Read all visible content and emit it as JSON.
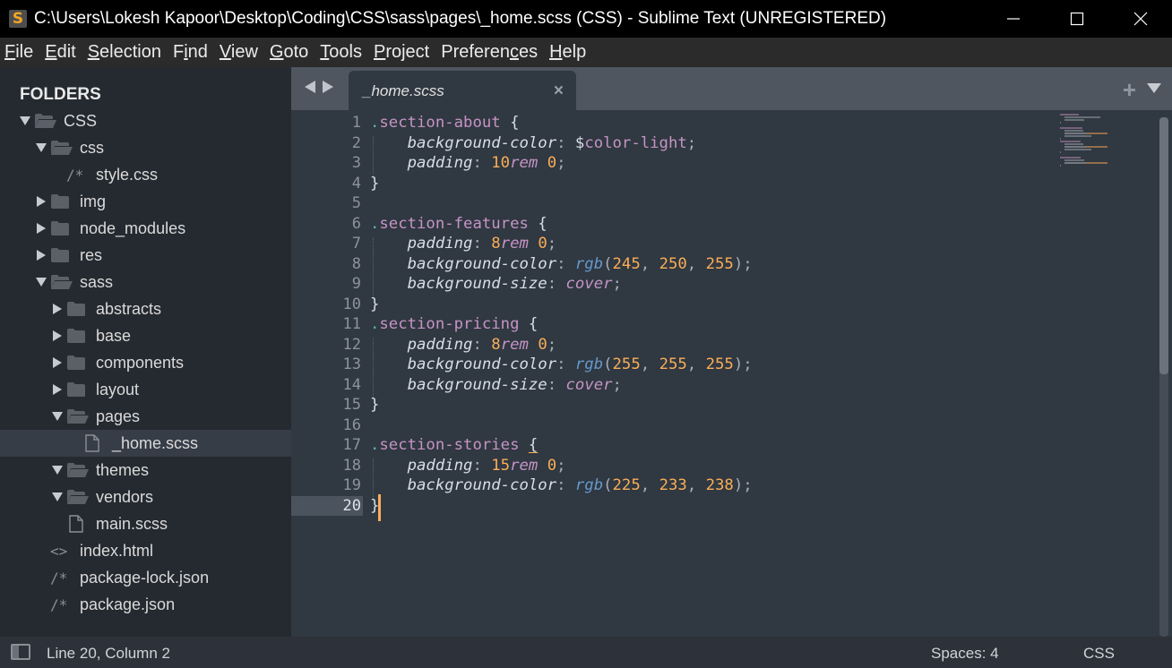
{
  "window": {
    "title": "C:\\Users\\Lokesh Kapoor\\Desktop\\Coding\\CSS\\sass\\pages\\_home.scss (CSS) - Sublime Text (UNREGISTERED)",
    "app_icon": "sublime-text-icon",
    "controls": [
      "minimize-icon",
      "maximize-icon",
      "close-icon"
    ]
  },
  "menu": {
    "items": [
      {
        "label": "File",
        "mnemonic_index": 0
      },
      {
        "label": "Edit",
        "mnemonic_index": 0
      },
      {
        "label": "Selection",
        "mnemonic_index": 0
      },
      {
        "label": "Find",
        "mnemonic_index": 1
      },
      {
        "label": "View",
        "mnemonic_index": 0
      },
      {
        "label": "Goto",
        "mnemonic_index": 0
      },
      {
        "label": "Tools",
        "mnemonic_index": 0
      },
      {
        "label": "Project",
        "mnemonic_index": 0
      },
      {
        "label": "Preferences",
        "mnemonic_index": 8
      },
      {
        "label": "Help",
        "mnemonic_index": 0
      }
    ]
  },
  "sidebar": {
    "header": "FOLDERS",
    "tree": [
      {
        "label": "CSS",
        "type": "folder",
        "depth": 0,
        "expanded": true
      },
      {
        "label": "css",
        "type": "folder",
        "depth": 1,
        "expanded": true
      },
      {
        "label": "style.css",
        "type": "file",
        "depth": 2,
        "glyph": "/*"
      },
      {
        "label": "img",
        "type": "folder",
        "depth": 1,
        "expanded": false
      },
      {
        "label": "node_modules",
        "type": "folder",
        "depth": 1,
        "expanded": false
      },
      {
        "label": "res",
        "type": "folder",
        "depth": 1,
        "expanded": false
      },
      {
        "label": "sass",
        "type": "folder",
        "depth": 1,
        "expanded": true
      },
      {
        "label": "abstracts",
        "type": "folder",
        "depth": 2,
        "expanded": false
      },
      {
        "label": "base",
        "type": "folder",
        "depth": 2,
        "expanded": false
      },
      {
        "label": "components",
        "type": "folder",
        "depth": 2,
        "expanded": false
      },
      {
        "label": "layout",
        "type": "folder",
        "depth": 2,
        "expanded": false
      },
      {
        "label": "pages",
        "type": "folder",
        "depth": 2,
        "expanded": true
      },
      {
        "label": "_home.scss",
        "type": "file",
        "depth": 3,
        "glyph": "page",
        "selected": true
      },
      {
        "label": "themes",
        "type": "folder",
        "depth": 2,
        "expanded": true
      },
      {
        "label": "vendors",
        "type": "folder",
        "depth": 2,
        "expanded": true
      },
      {
        "label": "main.scss",
        "type": "file",
        "depth": 2,
        "glyph": "page"
      },
      {
        "label": "index.html",
        "type": "file",
        "depth": 1,
        "glyph": "<>"
      },
      {
        "label": "package-lock.json",
        "type": "file",
        "depth": 1,
        "glyph": "/*"
      },
      {
        "label": "package.json",
        "type": "file",
        "depth": 1,
        "glyph": "/*"
      }
    ]
  },
  "tabs": {
    "active": {
      "label": "_home.scss",
      "close_icon": "close-icon"
    },
    "new_tab_icon": "plus-icon",
    "tab_menu_icon": "chevron-down-icon",
    "nav": [
      "arrow-left-icon",
      "arrow-right-icon"
    ]
  },
  "editor": {
    "current_line": 20,
    "lines": [
      ".section-about {",
      "    background-color: $color-light;",
      "    padding: 10rem 0;",
      "}",
      "",
      ".section-features {",
      "    padding: 8rem 0;",
      "    background-color: rgb(245, 250, 255);",
      "    background-size: cover;",
      "}",
      ".section-pricing {",
      "    padding: 8rem 0;",
      "    background-color: rgb(255, 255, 255);",
      "    background-size: cover;",
      "}",
      "",
      ".section-stories {",
      "    padding: 15rem 0;",
      "    background-color: rgb(225, 233, 238);",
      "}"
    ]
  },
  "statusbar": {
    "position": "Line 20, Column 2",
    "indentation": "Spaces: 4",
    "syntax": "CSS"
  },
  "colors": {
    "accent": "#f9ae58",
    "selector": "#c594c5",
    "function": "#6699cc",
    "background": "#303841",
    "sidebar": "#252a30"
  }
}
